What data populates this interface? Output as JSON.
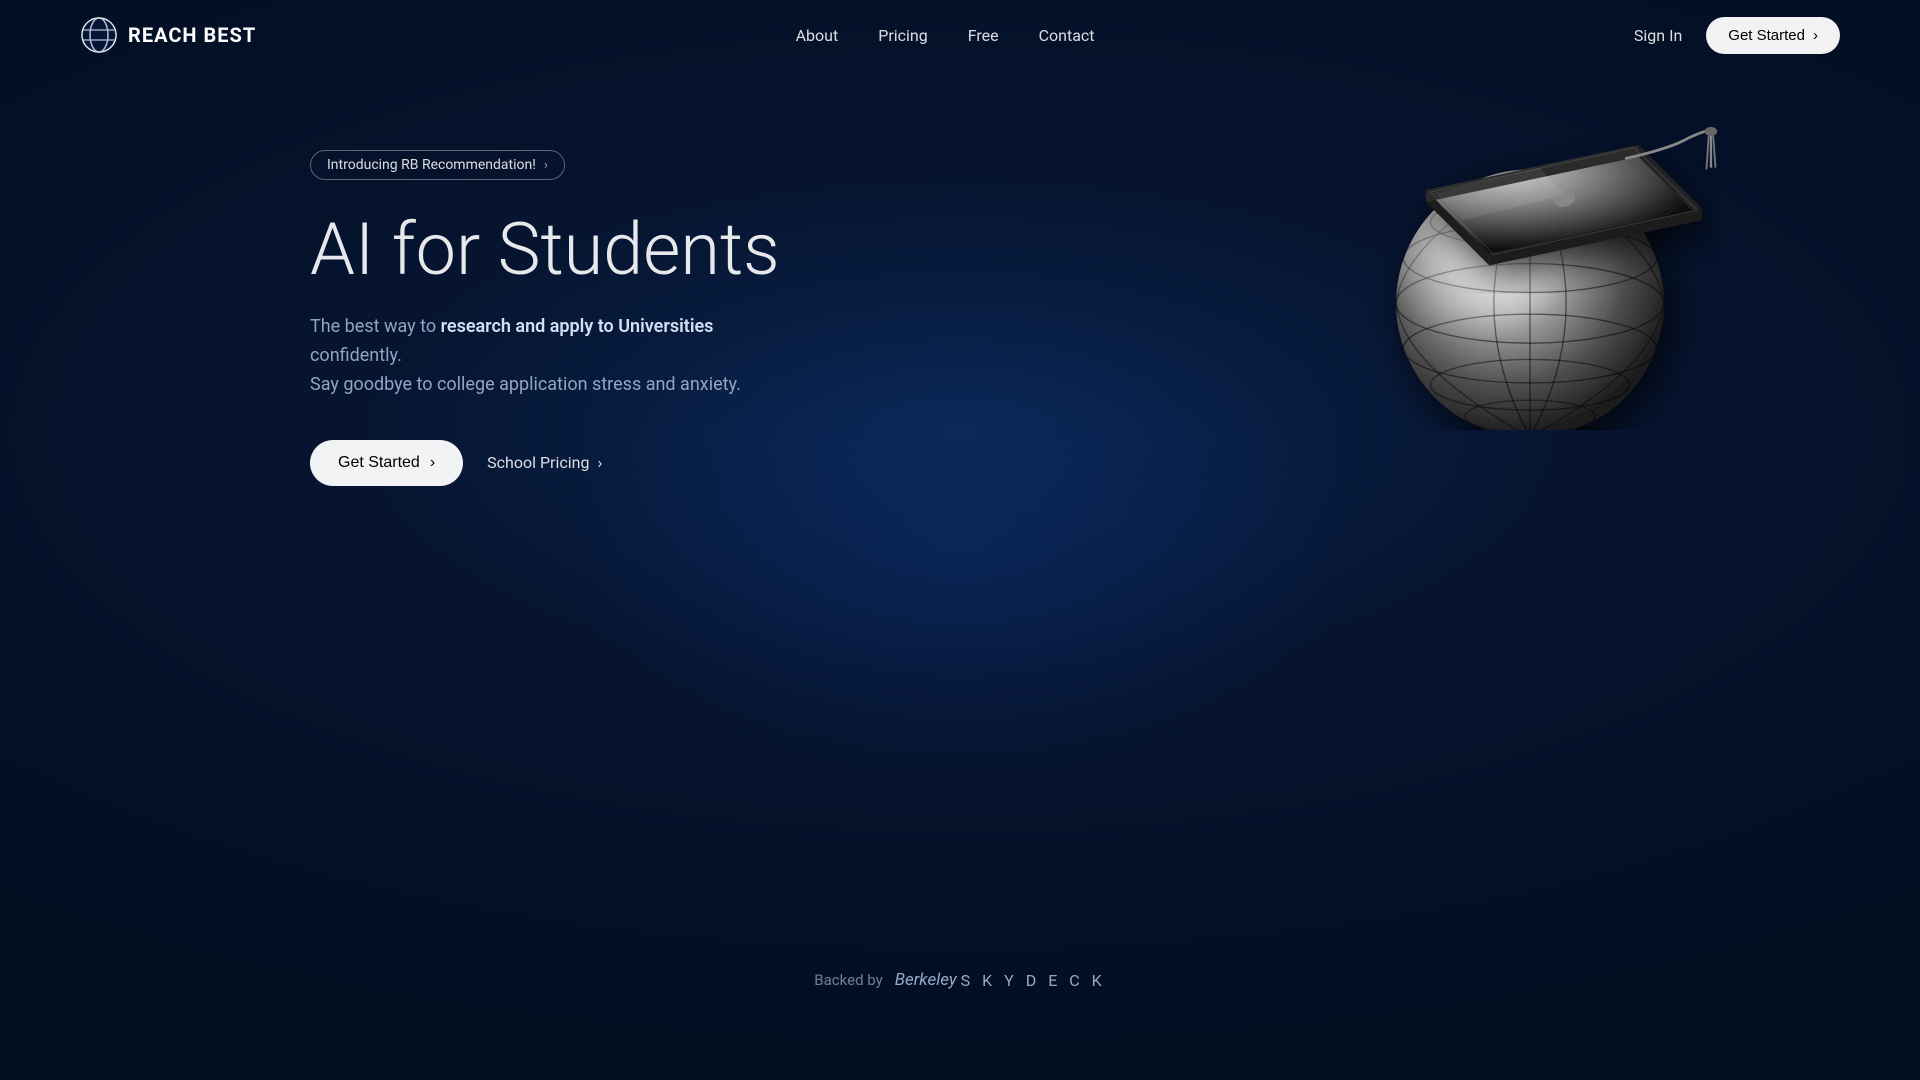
{
  "site": {
    "logo_text": "REACH BEST",
    "logo_icon": "globe-icon"
  },
  "nav": {
    "links": [
      {
        "label": "About",
        "id": "about"
      },
      {
        "label": "Pricing",
        "id": "pricing"
      },
      {
        "label": "Free",
        "id": "free"
      },
      {
        "label": "Contact",
        "id": "contact"
      }
    ],
    "sign_in": "Sign In",
    "get_started": "Get Started",
    "chevron": "›"
  },
  "hero": {
    "announcement": "Introducing RB Recommendation!",
    "announcement_chevron": "›",
    "title": "AI for Students",
    "subtitle_plain": "The best way to ",
    "subtitle_bold": "research and apply to Universities",
    "subtitle_end": " confidently.\nSay goodbye to college application stress and anxiety.",
    "get_started_label": "Get Started",
    "get_started_chevron": "›",
    "school_pricing_label": "School Pricing",
    "school_pricing_chevron": "›"
  },
  "footer": {
    "backed_by": "Backed by",
    "backer_name": "Berkeley",
    "backer_brand": "S K Y D E C K"
  }
}
